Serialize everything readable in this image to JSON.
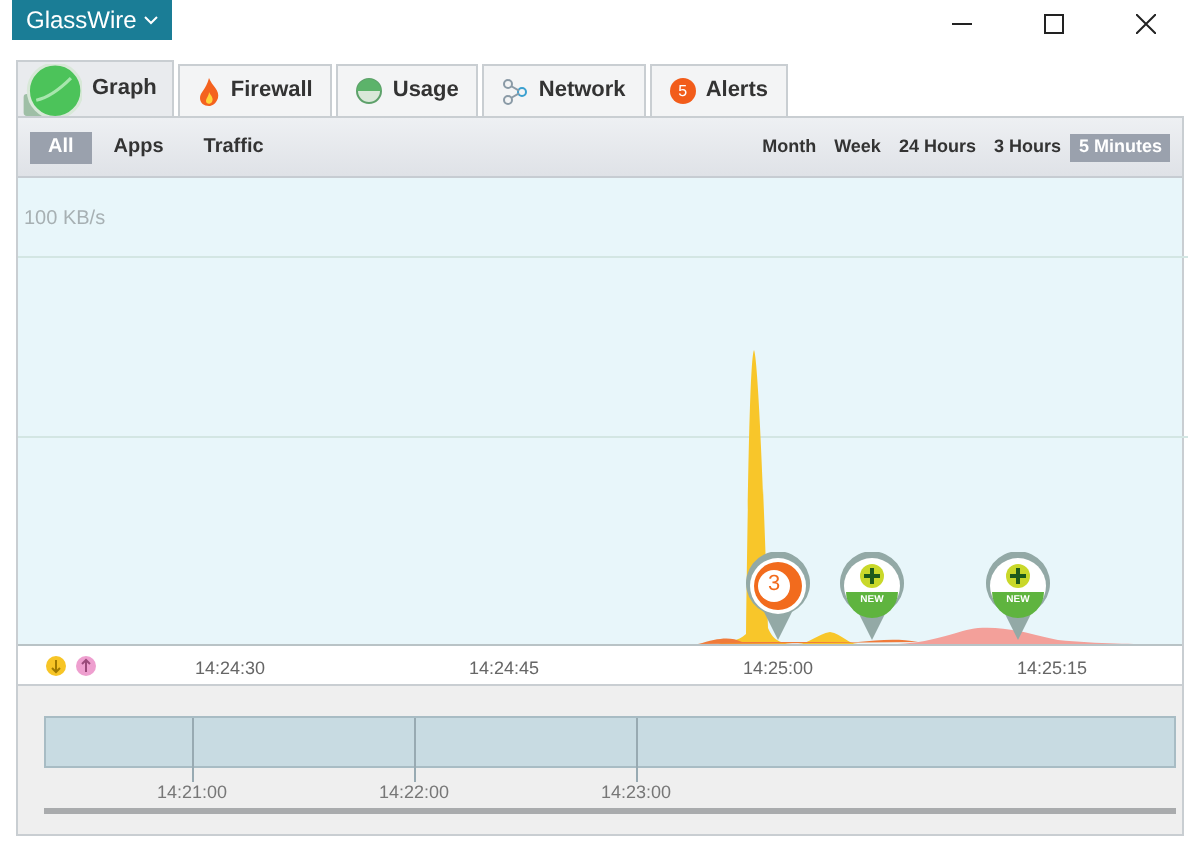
{
  "app_menu": {
    "label": "GlassWire"
  },
  "tabs": [
    {
      "kind": "graph",
      "label": "Graph",
      "selected": true
    },
    {
      "kind": "firewall",
      "label": "Firewall",
      "selected": false
    },
    {
      "kind": "usage",
      "label": "Usage",
      "selected": false
    },
    {
      "kind": "network",
      "label": "Network",
      "selected": false
    },
    {
      "kind": "alerts",
      "label": "Alerts",
      "badge": "5",
      "selected": false
    }
  ],
  "filters": [
    {
      "label": "All",
      "selected": true
    },
    {
      "label": "Apps",
      "selected": false
    },
    {
      "label": "Traffic",
      "selected": false
    }
  ],
  "ranges": [
    {
      "label": "Month",
      "selected": false
    },
    {
      "label": "Week",
      "selected": false
    },
    {
      "label": "24 Hours",
      "selected": false
    },
    {
      "label": "3 Hours",
      "selected": false
    },
    {
      "label": "5 Minutes",
      "selected": true
    }
  ],
  "graph": {
    "scale_label": "100 KB/s",
    "time_labels": [
      "14:24:30",
      "14:24:45",
      "14:25:00",
      "14:25:15"
    ],
    "events": [
      {
        "kind": "alert",
        "count": "3"
      },
      {
        "kind": "new_app",
        "label": "NEW"
      },
      {
        "kind": "new_app",
        "label": "NEW"
      }
    ]
  },
  "overview": {
    "time_labels": [
      "14:21:00",
      "14:22:00",
      "14:23:00"
    ]
  }
}
